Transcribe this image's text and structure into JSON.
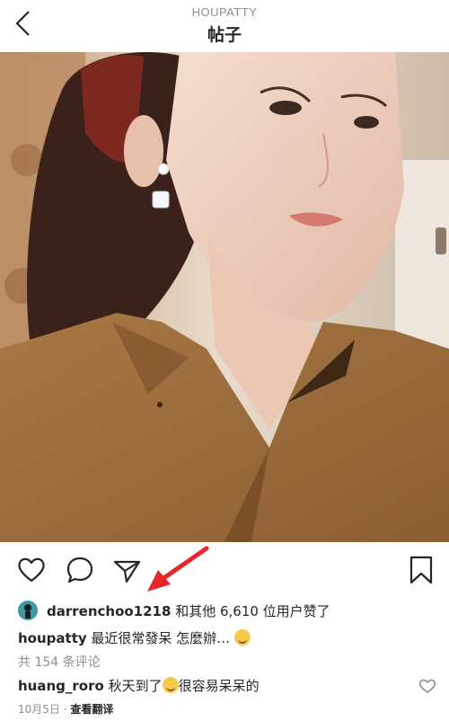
{
  "header": {
    "account": "HOUPATTY",
    "title": "帖子"
  },
  "photo": {
    "alt": ""
  },
  "likes": {
    "user": "darrenchoo1218",
    "rest": " 和其他 6,610 位用户赞了"
  },
  "caption": {
    "user": "houpatty",
    "text": " 最近很常發呆 怎麼辦…"
  },
  "comments": {
    "count_text": "共 154 条评论"
  },
  "comment": {
    "user": "huang_roro",
    "text_before": " 秋天到了",
    "text_after": "很容易呆呆的"
  },
  "meta": {
    "date": "10月5日",
    "separator": " · ",
    "translate": "查看翻译"
  },
  "colors": {
    "accent_annotation": "#e8262a",
    "muted": "#8e8e8e",
    "text": "#262626"
  }
}
